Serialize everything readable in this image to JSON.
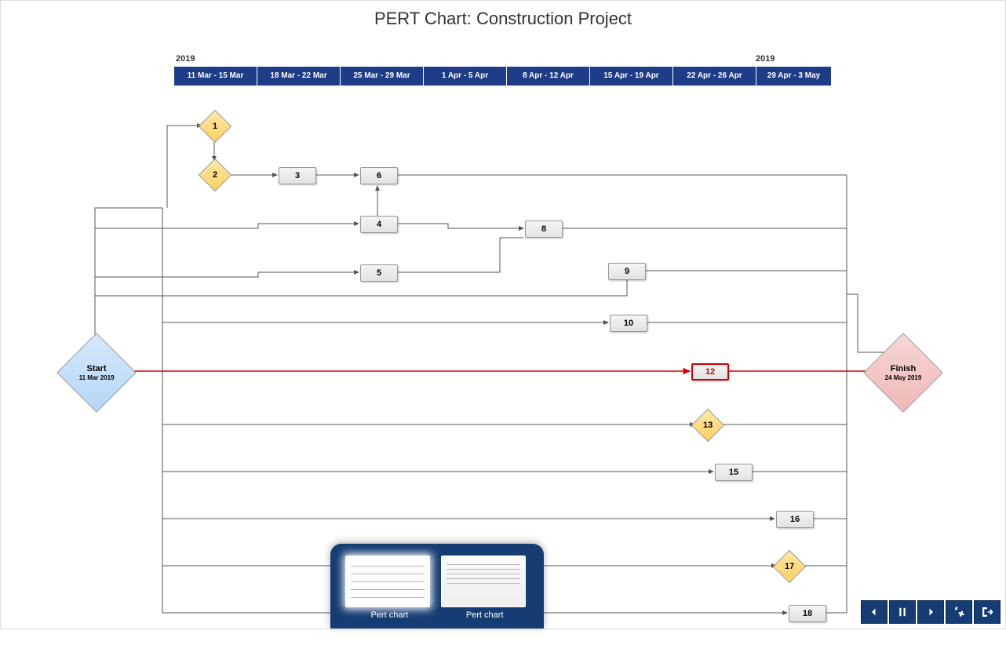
{
  "title": "PERT Chart: Construction Project",
  "timeline": {
    "year_left": "2019",
    "year_right": "2019",
    "weeks": [
      "11 Mar - 15 Mar",
      "18 Mar - 22 Mar",
      "25 Mar - 29 Mar",
      "1 Apr - 5 Apr",
      "8 Apr - 12 Apr",
      "15 Apr - 19 Apr",
      "22 Apr - 26 Apr",
      "29 Apr - 3 May"
    ]
  },
  "start": {
    "label": "Start",
    "date": "11 Mar 2019"
  },
  "finish": {
    "label": "Finish",
    "date": "24 May 2019"
  },
  "nodes": {
    "n1": {
      "id": "1",
      "type": "milestone"
    },
    "n2": {
      "id": "2",
      "type": "milestone"
    },
    "n3": {
      "id": "3",
      "type": "task"
    },
    "n4": {
      "id": "4",
      "type": "task"
    },
    "n5": {
      "id": "5",
      "type": "task"
    },
    "n6": {
      "id": "6",
      "type": "task"
    },
    "n8": {
      "id": "8",
      "type": "task"
    },
    "n9": {
      "id": "9",
      "type": "task"
    },
    "n10": {
      "id": "10",
      "type": "task"
    },
    "n12": {
      "id": "12",
      "type": "task",
      "critical": true
    },
    "n13": {
      "id": "13",
      "type": "milestone"
    },
    "n15": {
      "id": "15",
      "type": "task"
    },
    "n16": {
      "id": "16",
      "type": "task"
    },
    "n17": {
      "id": "17",
      "type": "milestone"
    },
    "n18": {
      "id": "18",
      "type": "task"
    }
  },
  "thumbs": {
    "a": "Pert chart",
    "b": "Pert chart"
  }
}
